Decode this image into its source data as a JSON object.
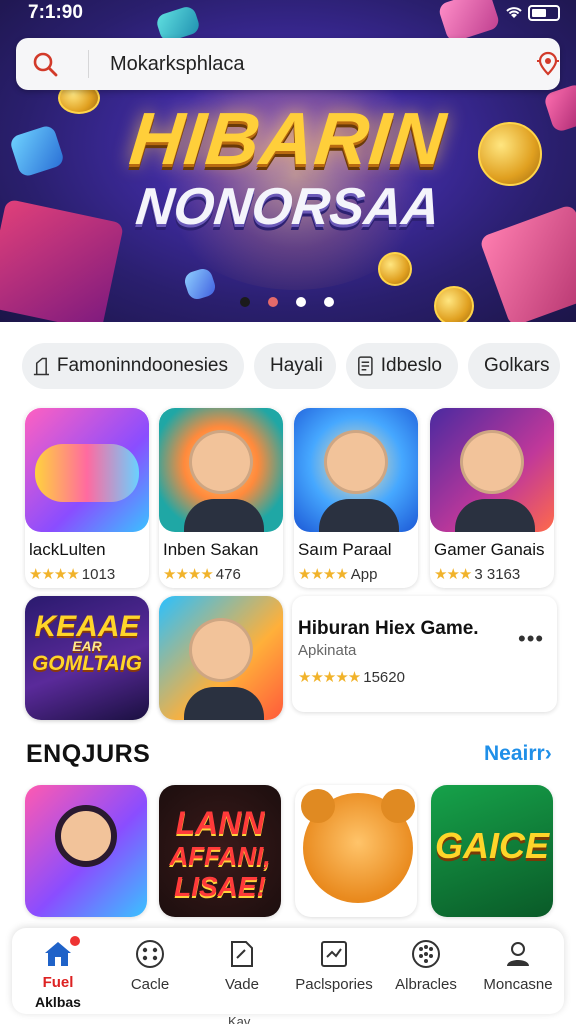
{
  "status_bar": {
    "time": "7:1:90"
  },
  "search": {
    "query": "Mokarksphlaca"
  },
  "banner": {
    "line1": "HIBARIN",
    "line2": "NONORSAA",
    "active_dot": 0,
    "dot_count": 4
  },
  "chips": [
    {
      "label": "Famoninndoonesies",
      "icon": "controller-icon"
    },
    {
      "label": "Hayali"
    },
    {
      "label": "Idbeslo",
      "icon": "document-icon"
    },
    {
      "label": "Golkars"
    }
  ],
  "apps_row1": [
    {
      "name": "lackLulten",
      "stars": "★★★★",
      "meta": "1013"
    },
    {
      "name": "Inben Sakan",
      "stars": "★★★★",
      "meta": "476"
    },
    {
      "name": "Saım Paraal",
      "stars": "★★★★",
      "meta": "App"
    },
    {
      "name": "Gamer Ganais",
      "stars": "★★★",
      "meta": "3 3163"
    }
  ],
  "apps_row2": [
    {
      "icon_text": [
        "KEAAE",
        "EAR",
        "GOMLTAIG"
      ]
    }
  ],
  "featured": {
    "title": "Hiburan Hiex Game.",
    "subtitle": "Apkinata",
    "stars": "★★★★★",
    "reviews": "15620",
    "more": "•••"
  },
  "section": {
    "title": "ENQJURS",
    "link": "Neairr"
  },
  "tiles": [
    {
      "icon": "girl-tile"
    },
    {
      "lines": [
        "LANN",
        "AFFANI,",
        "LISAE!"
      ]
    },
    {
      "icon": "bear-tile"
    },
    {
      "text": "GAICE"
    }
  ],
  "bottom_nav": [
    {
      "label": "Fuel",
      "sublabel": "Aklbas",
      "icon": "home-icon",
      "active": true
    },
    {
      "label": "Cacle",
      "icon": "dice-icon"
    },
    {
      "label": "Vade",
      "icon": "edit-icon"
    },
    {
      "label": "Paclspories",
      "icon": "media-icon"
    },
    {
      "label": "Albracles",
      "icon": "grid-icon"
    },
    {
      "label": "Moncasne",
      "icon": "person-icon"
    }
  ],
  "peek_text": "Kav",
  "colors": {
    "accent": "#1f8fe8",
    "star": "#f1b32b",
    "active_nav": "#d22222"
  }
}
